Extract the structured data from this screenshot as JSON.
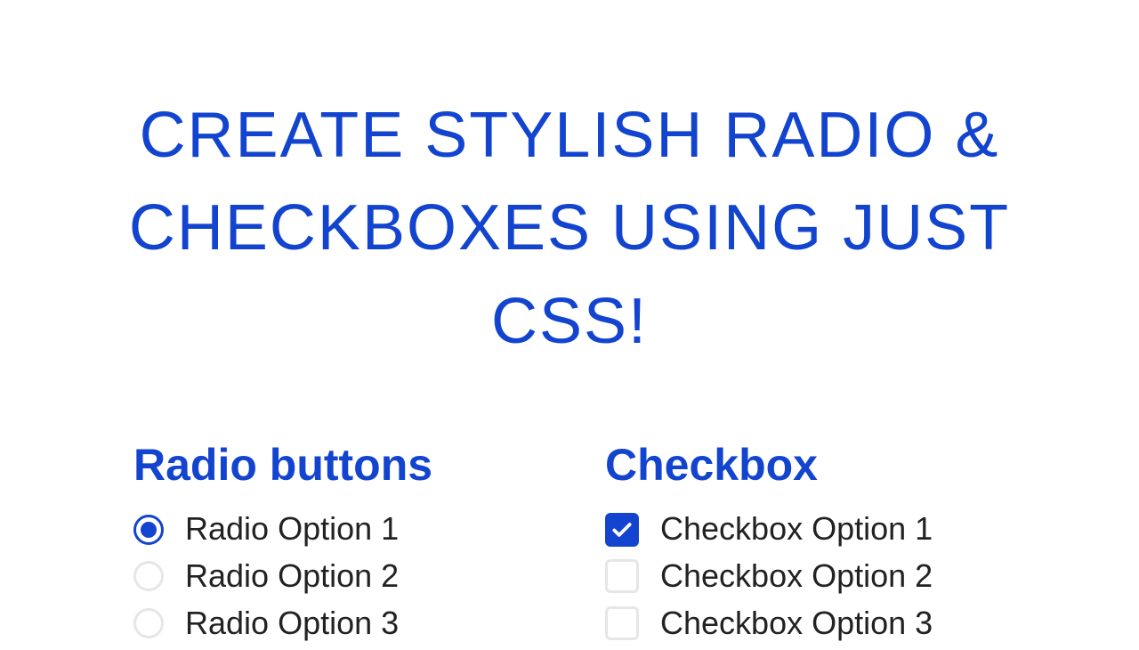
{
  "headline": "CREATE STYLISH RADIO & CHECKBOXES USING JUST CSS!",
  "radio": {
    "heading": "Radio buttons",
    "options": [
      {
        "label": "Radio Option 1",
        "checked": true
      },
      {
        "label": "Radio Option 2",
        "checked": false
      },
      {
        "label": "Radio Option 3",
        "checked": false
      }
    ]
  },
  "checkbox": {
    "heading": "Checkbox",
    "options": [
      {
        "label": "Checkbox Option 1",
        "checked": true
      },
      {
        "label": "Checkbox Option 2",
        "checked": false
      },
      {
        "label": "Checkbox Option 3",
        "checked": false
      }
    ]
  },
  "colors": {
    "accent": "#1244cf",
    "inactive_border": "#e6e6e6",
    "text": "#222222"
  }
}
